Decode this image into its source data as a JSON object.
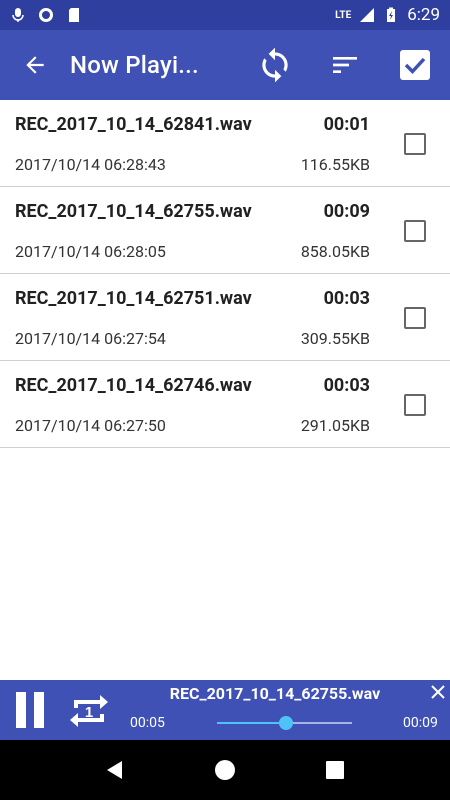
{
  "status_bar": {
    "network": "LTE",
    "time": "6:29"
  },
  "app_bar": {
    "title": "Now Playi..."
  },
  "recordings": [
    {
      "name": "REC_2017_10_14_62841.wav",
      "duration": "00:01",
      "date": "2017/10/14 06:28:43",
      "size": "116.55KB"
    },
    {
      "name": "REC_2017_10_14_62755.wav",
      "duration": "00:09",
      "date": "2017/10/14 06:28:05",
      "size": "858.05KB"
    },
    {
      "name": "REC_2017_10_14_62751.wav",
      "duration": "00:03",
      "date": "2017/10/14 06:27:54",
      "size": "309.55KB"
    },
    {
      "name": "REC_2017_10_14_62746.wav",
      "duration": "00:03",
      "date": "2017/10/14 06:27:50",
      "size": "291.05KB"
    }
  ],
  "player": {
    "title": "REC_2017_10_14_62755.wav",
    "current_time": "00:05",
    "total_time": "00:09",
    "repeat_label": "1",
    "progress_fraction": 0.51,
    "accent_color": "#4fc3f7"
  },
  "colors": {
    "primary": "#3f51b5",
    "status_bar": "#2f3f9f"
  }
}
